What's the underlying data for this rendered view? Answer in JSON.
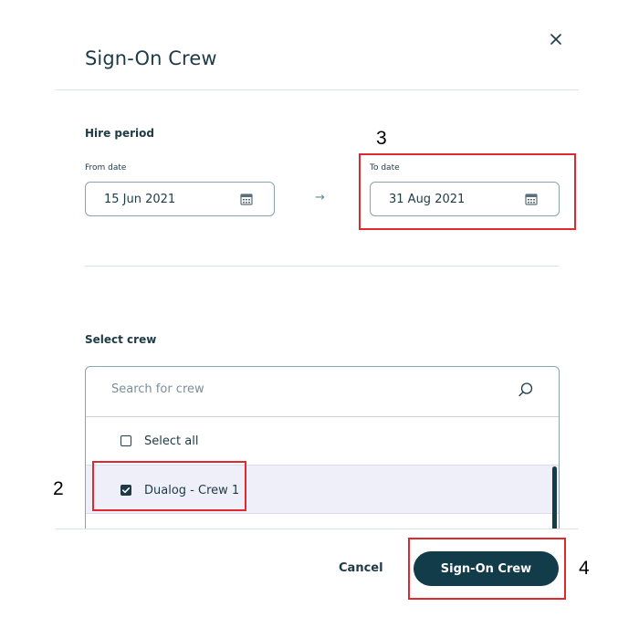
{
  "dialog": {
    "title": "Sign-On Crew",
    "close_icon": "close-icon"
  },
  "hire_period": {
    "label": "Hire period",
    "from": {
      "label": "From date",
      "value": "15 Jun 2021",
      "icon": "calendar-icon"
    },
    "arrow": "→",
    "to": {
      "label": "To date",
      "value": "31 Aug 2021",
      "icon": "calendar-icon"
    }
  },
  "select_crew": {
    "label": "Select crew",
    "search": {
      "placeholder": "Search for crew",
      "icon": "search-icon"
    },
    "select_all": {
      "label": "Select all",
      "checked": false
    },
    "items": [
      {
        "label": "Dualog - Crew 1",
        "checked": true
      }
    ]
  },
  "footer": {
    "cancel_label": "Cancel",
    "primary_label": "Sign-On Crew"
  },
  "annotations": {
    "step2": "2",
    "step3": "3",
    "step4": "4",
    "highlight_color": "#e0282f"
  },
  "colors": {
    "primary": "#123c49",
    "text": "#1e3a46",
    "selected_row": "#eeeff9"
  }
}
